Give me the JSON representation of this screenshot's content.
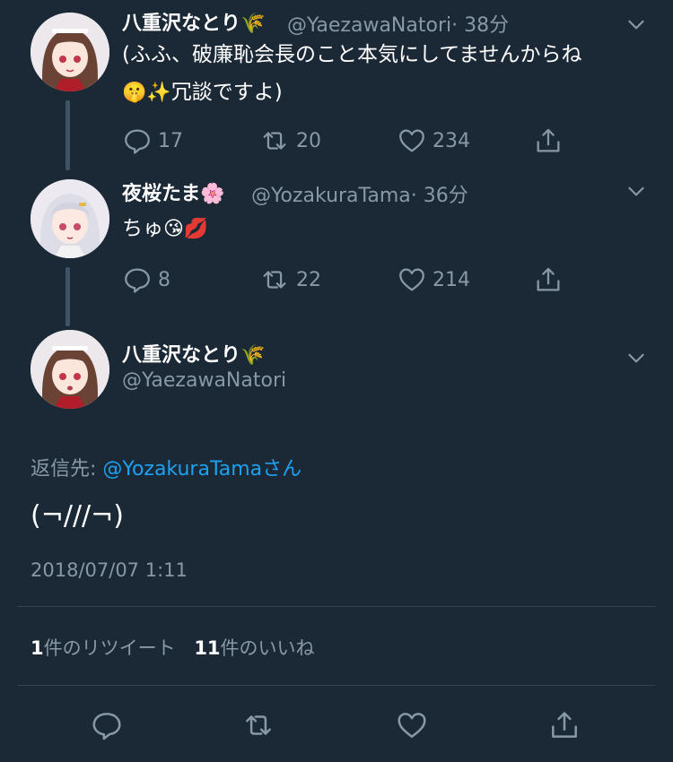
{
  "tweets": [
    {
      "name": "八重沢なとり",
      "name_emoji": "🌾",
      "handle": "@YaezawaNatori",
      "time": "· 38分",
      "text_line1": "(ふふ、破廉恥会長のこと本気にしてませんからね",
      "text_line2_emoji": "🤫✨",
      "text_line2": "冗談ですよ)",
      "replies": "17",
      "retweets": "20",
      "likes": "234"
    },
    {
      "name": "夜桜たま",
      "name_emoji": "🌸",
      "handle": "@YozakuraTama",
      "time": "· 36分",
      "text": "ちゅ",
      "text_emoji": "😘💋",
      "replies": "8",
      "retweets": "22",
      "likes": "214"
    }
  ],
  "focused": {
    "name": "八重沢なとり",
    "name_emoji": "🌾",
    "handle": "@YaezawaNatori",
    "reply_to_label": "返信先:",
    "reply_to_user": "@YozakuraTama",
    "reply_to_suffix": "さん",
    "text": "(¬///¬)",
    "timestamp": "2018/07/07 1:11",
    "retweet_count": "1",
    "retweet_label": "件のリツイート",
    "like_count": "11",
    "like_label": "件のいいね"
  },
  "icons": [
    "reply-icon",
    "retweet-icon",
    "like-icon",
    "share-icon",
    "chevron-down-icon"
  ]
}
